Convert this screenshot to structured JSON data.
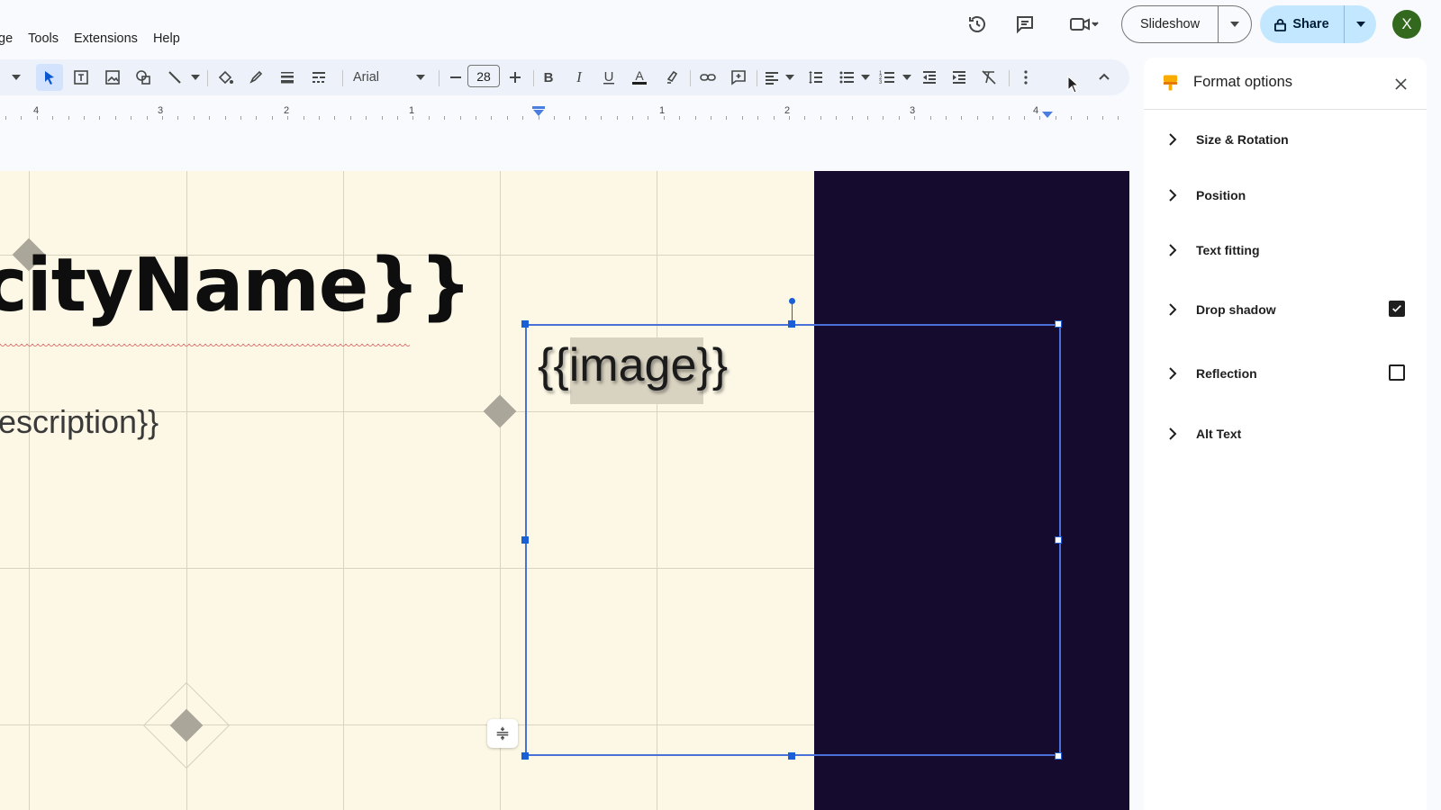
{
  "menu": [
    "ge",
    "Tools",
    "Extensions",
    "Help"
  ],
  "header": {
    "slideshow_label": "Slideshow",
    "share_label": "Share",
    "avatar_letter": "X"
  },
  "toolbar": {
    "font_name": "Arial",
    "font_size": "28"
  },
  "ruler": {
    "labels": [
      "4",
      "3",
      "2",
      "1",
      "1",
      "2",
      "3",
      "4"
    ]
  },
  "slide": {
    "title": "cityName}}",
    "description": "escription}}",
    "image_placeholder": "{{image}}"
  },
  "panel": {
    "title": "Format options",
    "options": [
      {
        "label": "Size & Rotation"
      },
      {
        "label": "Position"
      },
      {
        "label": "Text fitting"
      },
      {
        "label": "Drop shadow",
        "checked": true
      },
      {
        "label": "Reflection",
        "checked": false
      },
      {
        "label": "Alt Text"
      }
    ]
  },
  "colors": {
    "accent": "#1a5fd6",
    "slide_bg": "#fdf8e6",
    "slide_dark": "#140b2e",
    "share_bg": "#c2e7ff",
    "avatar_bg": "#33691e"
  }
}
